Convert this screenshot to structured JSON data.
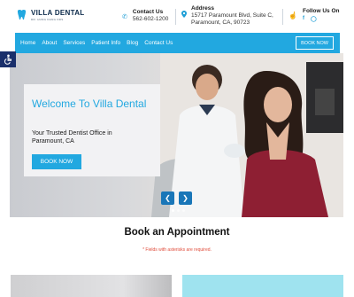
{
  "brand": {
    "name": "VILLA DENTAL",
    "subtitle": "DR. HUNG DANG DDS",
    "accent": "#22a8e0"
  },
  "contact": {
    "title": "Contact Us",
    "phone": "562-602-1200",
    "icon": "phone-icon"
  },
  "address": {
    "title": "Address",
    "line1": "15717 Paramount Blvd, Suite C,",
    "line2": "Paramount, CA, 90723",
    "icon": "location-pin-icon"
  },
  "follow": {
    "title": "Follow Us On",
    "icon": "hand-pointer-icon",
    "social": [
      "facebook-icon",
      "instagram-icon"
    ]
  },
  "nav": {
    "items": [
      "Home",
      "About",
      "Services",
      "Patient Info",
      "Blog",
      "Contact Us"
    ],
    "book_label": "BOOK NOW"
  },
  "hero": {
    "title": "Welcome To Villa Dental",
    "subtitle": "Your Trusted Dentist Office in Paramount, CA",
    "button": "BOOK NOW",
    "prev_icon": "chevron-left-icon",
    "next_icon": "chevron-right-icon",
    "slide_count": 3,
    "active_slide": 1
  },
  "appointment": {
    "title": "Book an Appointment",
    "note": "* Fields with asterisks are required."
  }
}
